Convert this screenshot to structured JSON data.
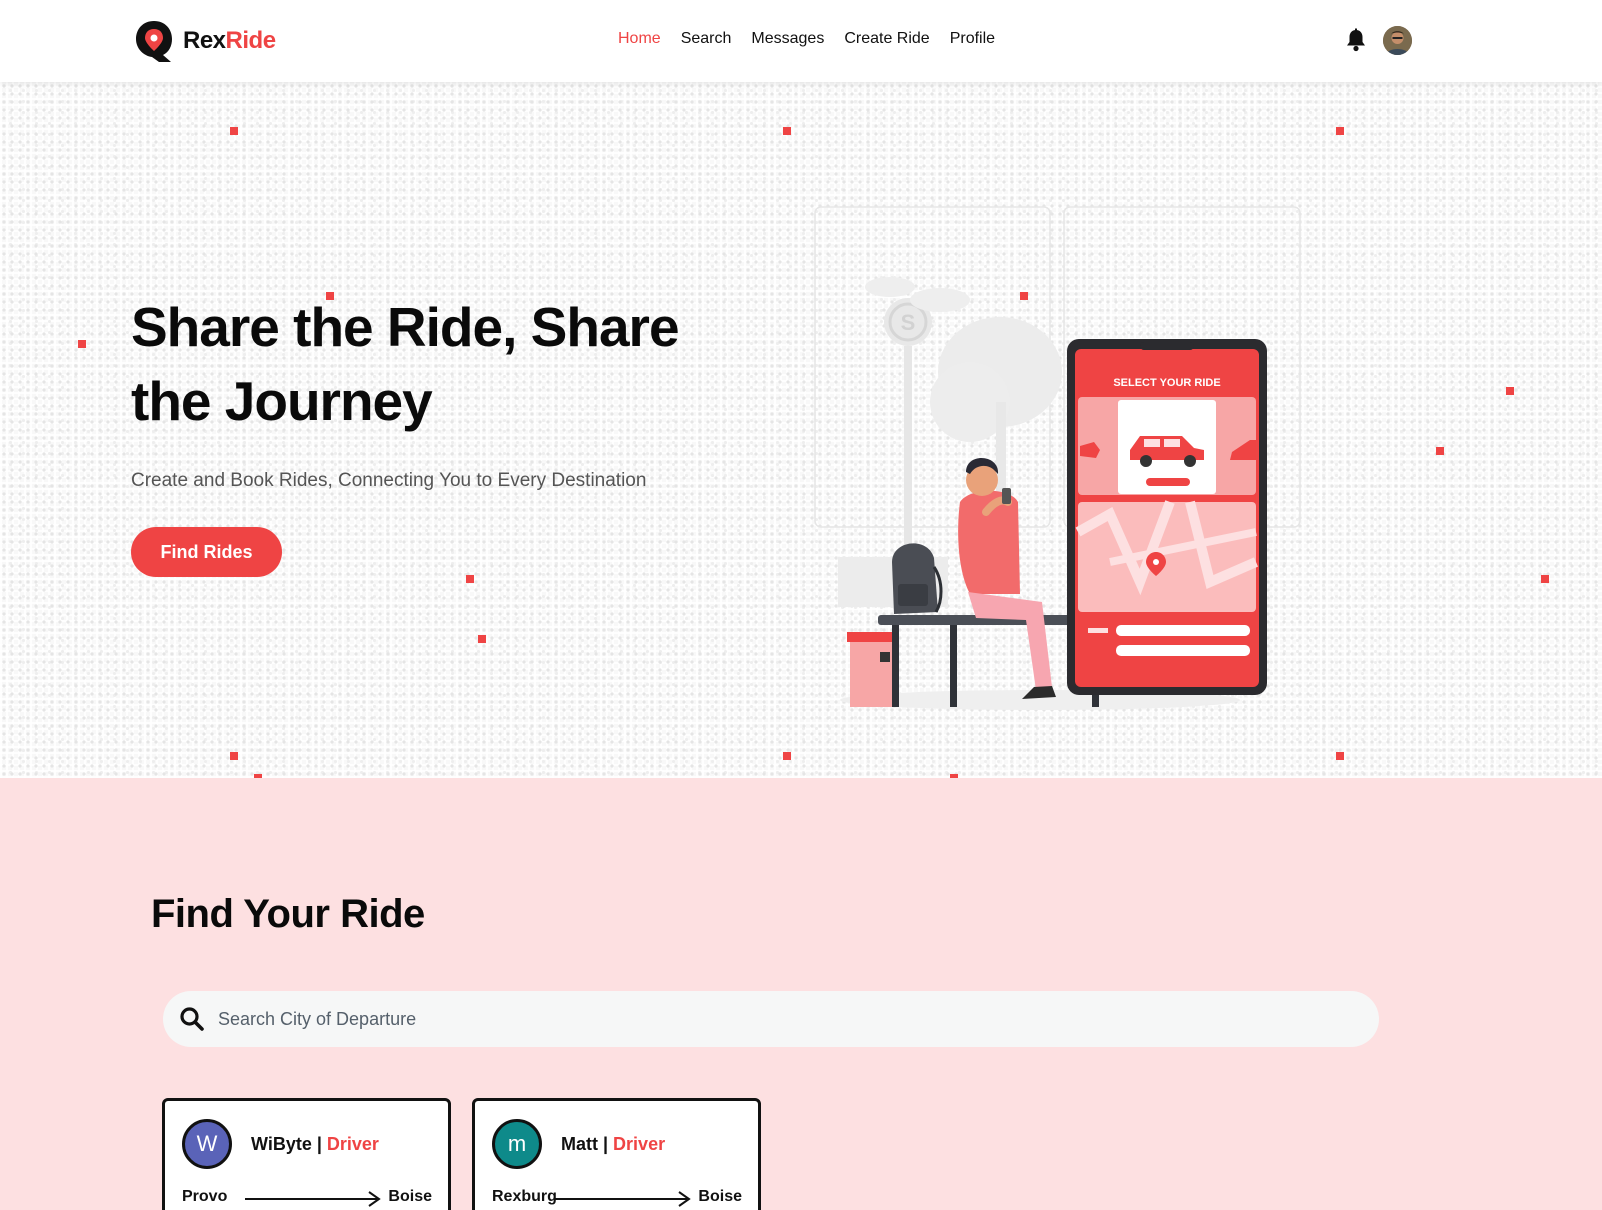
{
  "brand": {
    "part1": "Rex",
    "part2": "Ride"
  },
  "nav": {
    "items": [
      {
        "label": "Home",
        "active": true
      },
      {
        "label": "Search",
        "active": false
      },
      {
        "label": "Messages",
        "active": false
      },
      {
        "label": "Create Ride",
        "active": false
      },
      {
        "label": "Profile",
        "active": false
      }
    ]
  },
  "hero": {
    "title": "Share the Ride, Share the Journey",
    "subtitle": "Create and Book Rides, Connecting You to Every Destination",
    "cta_label": "Find Rides",
    "illustration": {
      "screen_label": "SELECT YOUR RIDE"
    }
  },
  "find": {
    "title": "Find Your Ride",
    "search_placeholder": "Search City of Departure"
  },
  "rides": [
    {
      "initial": "W",
      "name": "WiByte",
      "separator": " | ",
      "role": "Driver",
      "from": "Provo",
      "to": "Boise",
      "avatar_color": "#5a63b8"
    },
    {
      "initial": "m",
      "name": "Matt",
      "separator": " | ",
      "role": "Driver",
      "from": "Rexburg",
      "to": "Boise",
      "avatar_color": "#0e8a8a"
    }
  ],
  "colors": {
    "accent": "#ef4444",
    "section_bg": "#fde0e1"
  },
  "icons": [
    "logo-pin-icon",
    "bell-icon",
    "search-icon",
    "arrow-right-icon"
  ]
}
